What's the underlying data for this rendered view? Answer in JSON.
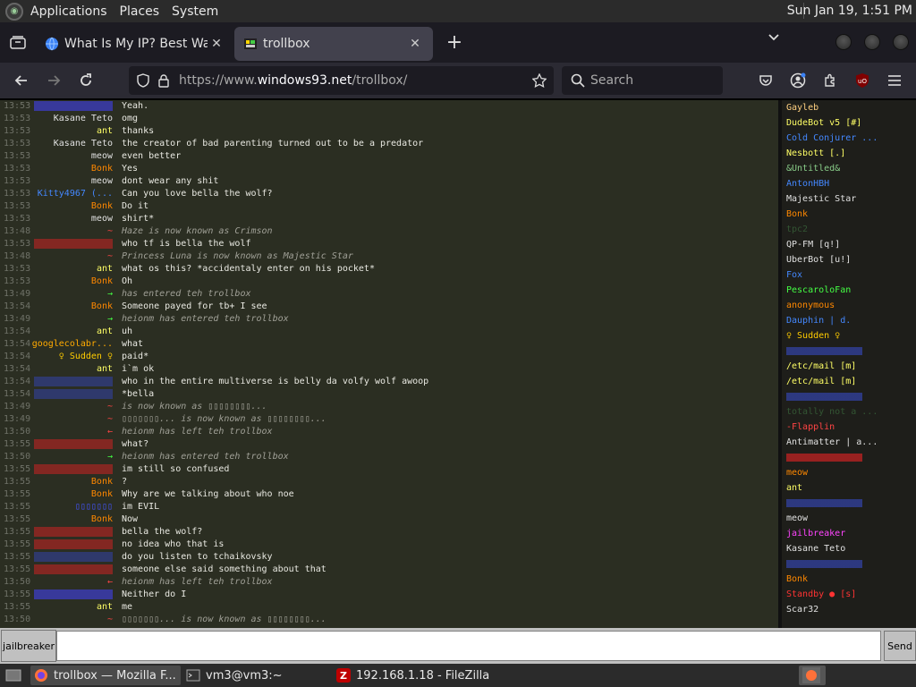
{
  "top_panel": {
    "menus": [
      "Applications",
      "Places",
      "System"
    ],
    "clock": "Sun Jan 19,  1:51 PM"
  },
  "tabs": [
    {
      "title": "What Is My IP? Best Way To",
      "active": false
    },
    {
      "title": "trollbox",
      "active": true
    }
  ],
  "nav": {
    "url_prefix": "https://www.",
    "url_domain": "windows93.net",
    "url_path": "/trollbox/",
    "search_placeholder": "Search"
  },
  "colors": {
    "accent": "#42414d",
    "chat_bg": "#2b2e22",
    "userlist_bg": "#1e1e1a",
    "time": "#6f7268",
    "text": "#e9e9e2"
  },
  "messages": [
    {
      "time": "13:53",
      "nick": "",
      "nick_color": "#4444ff",
      "text": "Yeah."
    },
    {
      "time": "13:53",
      "nick": "Kasane Teto",
      "nick_color": "#e0e0e0",
      "text": "omg"
    },
    {
      "time": "13:53",
      "nick": "ant",
      "nick_color": "#ffff66",
      "text": "thanks"
    },
    {
      "time": "13:53",
      "nick": "Kasane Teto",
      "nick_color": "#e0e0e0",
      "text": "the creator of bad parenting turned out to be a predator"
    },
    {
      "time": "13:53",
      "nick": "meow",
      "nick_color": "#e0e0e0",
      "text": "even better"
    },
    {
      "time": "13:53",
      "nick": "Bonk",
      "nick_color": "#ff8800",
      "text": "Yes"
    },
    {
      "time": "13:53",
      "nick": "meow",
      "nick_color": "#e0e0e0",
      "text": "dont wear any shit"
    },
    {
      "time": "13:53",
      "nick": "Kitty4967 (...",
      "nick_color": "#4488ff",
      "text": "Can you love bella the wolf?"
    },
    {
      "time": "13:53",
      "nick": "Bonk",
      "nick_color": "#ff8800",
      "text": "Do it"
    },
    {
      "time": "13:53",
      "nick": "meow",
      "nick_color": "#e0e0e0",
      "text": "shirt*"
    },
    {
      "time": "13:48",
      "nick": "~",
      "nick_color": "#ff4444",
      "text": "Haze is now known as Crimson",
      "system": true
    },
    {
      "time": "13:53",
      "nick": "",
      "nick_color": "#cc2222",
      "text": "who tf is bella the wolf"
    },
    {
      "time": "13:48",
      "nick": "~",
      "nick_color": "#ff4444",
      "text": "Princess Luna is now known as Majestic Star",
      "system": true
    },
    {
      "time": "13:53",
      "nick": "ant",
      "nick_color": "#ffff66",
      "text": "what os this? *accidentaly enter on his pocket*"
    },
    {
      "time": "13:53",
      "nick": "Bonk",
      "nick_color": "#ff8800",
      "text": "Oh"
    },
    {
      "time": "13:49",
      "nick": "→",
      "nick_color": "#44ff44",
      "text": "  has entered teh trollbox",
      "system": true
    },
    {
      "time": "13:54",
      "nick": "Bonk",
      "nick_color": "#ff8800",
      "text": "Someone payed for tb+ I see"
    },
    {
      "time": "13:49",
      "nick": "→",
      "nick_color": "#44ff44",
      "text": "heionm has entered teh trollbox",
      "system": true
    },
    {
      "time": "13:54",
      "nick": "ant",
      "nick_color": "#ffff66",
      "text": "uh"
    },
    {
      "time": "13:54",
      "nick": "googlecolabr...",
      "nick_color": "#ffaa00",
      "text": "what"
    },
    {
      "time": "13:54",
      "nick": "♀ Sudden ♀",
      "nick_color": "#ffcc00",
      "text": "paid*"
    },
    {
      "time": "13:54",
      "nick": "ant",
      "nick_color": "#ffff66",
      "text": "i`m ok"
    },
    {
      "time": "13:54",
      "nick": "",
      "nick_color": "#3344aa",
      "text": "who in the entire multiverse is belly da volfy wolf awoop"
    },
    {
      "time": "13:54",
      "nick": "",
      "nick_color": "#3344aa",
      "text": "*bella"
    },
    {
      "time": "13:49",
      "nick": "~",
      "nick_color": "#ff4444",
      "text": "  is now known as ▯▯▯▯▯▯▯▯...",
      "system": true
    },
    {
      "time": "13:49",
      "nick": "~",
      "nick_color": "#ff4444",
      "text": "▯▯▯▯▯▯▯... is now known as ▯▯▯▯▯▯▯▯...",
      "system": true
    },
    {
      "time": "13:50",
      "nick": "←",
      "nick_color": "#ff4444",
      "text": "heionm has left teh trollbox",
      "system": true
    },
    {
      "time": "13:55",
      "nick": "",
      "nick_color": "#cc2222",
      "text": "what?"
    },
    {
      "time": "13:50",
      "nick": "→",
      "nick_color": "#44ff44",
      "text": "heionm has entered teh trollbox",
      "system": true
    },
    {
      "time": "13:55",
      "nick": "",
      "nick_color": "#cc2222",
      "text": "im still so confused"
    },
    {
      "time": "13:55",
      "nick": "Bonk",
      "nick_color": "#ff8800",
      "text": "?"
    },
    {
      "time": "13:55",
      "nick": "Bonk",
      "nick_color": "#ff8800",
      "text": "Why are we talking about who noe"
    },
    {
      "time": "13:55",
      "nick": "▯▯▯▯▯▯▯",
      "nick_color": "#4455ff",
      "text": "im EVIL"
    },
    {
      "time": "13:55",
      "nick": "Bonk",
      "nick_color": "#ff8800",
      "text": "Now"
    },
    {
      "time": "13:55",
      "nick": "",
      "nick_color": "#cc2222",
      "text": "bella the wolf?"
    },
    {
      "time": "13:55",
      "nick": "",
      "nick_color": "#cc2222",
      "text": "no idea who that is"
    },
    {
      "time": "13:55",
      "nick": "",
      "nick_color": "#3344aa",
      "text": "do you listen to tchaikovsky"
    },
    {
      "time": "13:55",
      "nick": "",
      "nick_color": "#cc2222",
      "text": "someone else said something about that"
    },
    {
      "time": "13:50",
      "nick": "←",
      "nick_color": "#ff4444",
      "text": "heionm has left teh trollbox",
      "system": true
    },
    {
      "time": "13:55",
      "nick": "",
      "nick_color": "#4444ff",
      "text": "Neither do I"
    },
    {
      "time": "13:55",
      "nick": "ant",
      "nick_color": "#ffff66",
      "text": "me"
    },
    {
      "time": "13:50",
      "nick": "~",
      "nick_color": "#ff4444",
      "text": "▯▯▯▯▯▯▯... is now known as ▯▯▯▯▯▯▯▯...",
      "system": true
    }
  ],
  "users": [
    {
      "name": "Gayleb",
      "color": "#ffd080"
    },
    {
      "name": "DudeBot v5 [#]",
      "color": "#ffff66"
    },
    {
      "name": "Cold Conjurer ...",
      "color": "#4488ff"
    },
    {
      "name": "Nesbott [.]",
      "color": "#ffff66"
    },
    {
      "name": "&Untitled&",
      "color": "#88cc88"
    },
    {
      "name": "AntonHBH",
      "color": "#4488ff"
    },
    {
      "name": "Majestic Star",
      "color": "#e0e0e0"
    },
    {
      "name": "Bonk",
      "color": "#ff8800"
    },
    {
      "name": "tpc2",
      "color": "#335533"
    },
    {
      "name": "QP-FM [q!]",
      "color": "#e0e0e0"
    },
    {
      "name": "UberBot [u!]",
      "color": "#e0e0e0"
    },
    {
      "name": "Fox",
      "color": "#4488ff"
    },
    {
      "name": "PescaroloFan",
      "color": "#44ff44"
    },
    {
      "name": "anonymous",
      "color": "#ff8800"
    },
    {
      "name": "Dauphin | d.",
      "color": "#4488ff"
    },
    {
      "name": "♀ Sudden ♀",
      "color": "#ffcc00"
    },
    {
      "name": "",
      "color": "#3344aa"
    },
    {
      "name": "/etc/mail [m]",
      "color": "#ffff66"
    },
    {
      "name": "/etc/mail [m]",
      "color": "#ffff66"
    },
    {
      "name": "",
      "color": "#3344aa"
    },
    {
      "name": "totally not a ...",
      "color": "#335533"
    },
    {
      "name": "-Flapplin",
      "color": "#ff4444"
    },
    {
      "name": "Antimatter | a...",
      "color": "#e0e0e0"
    },
    {
      "name": "",
      "color": "#cc2222"
    },
    {
      "name": "meow",
      "color": "#ff8800"
    },
    {
      "name": "ant",
      "color": "#ffff66"
    },
    {
      "name": "",
      "color": "#3344aa"
    },
    {
      "name": "meow",
      "color": "#e0e0e0"
    },
    {
      "name": "jailbreaker",
      "color": "#ff44ff"
    },
    {
      "name": "Kasane Teto",
      "color": "#e0e0e0"
    },
    {
      "name": "",
      "color": "#3344aa"
    },
    {
      "name": "Bonk",
      "color": "#ff8800"
    },
    {
      "name": "Standby ● [s]",
      "color": "#ff3333"
    },
    {
      "name": "Scar32",
      "color": "#e0e0e0"
    }
  ],
  "input": {
    "nickname": "jailbreaker",
    "value": "",
    "send_label": "Send"
  },
  "taskbar": [
    {
      "label": "trollbox — Mozilla F...",
      "active": true
    },
    {
      "label": "vm3@vm3:~",
      "active": false
    },
    {
      "label": "192.168.1.18 - FileZilla",
      "active": false
    }
  ]
}
